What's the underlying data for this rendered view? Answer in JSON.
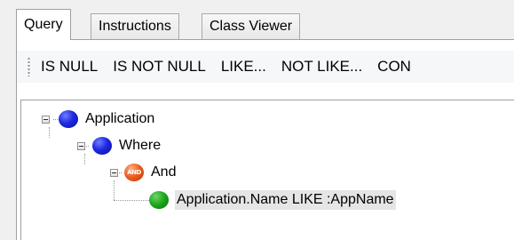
{
  "tabs": [
    {
      "label": "Query",
      "active": true
    },
    {
      "label": "Instructions",
      "active": false
    },
    {
      "label": "Class Viewer",
      "active": false
    }
  ],
  "toolbar": {
    "buttons": [
      "IS NULL",
      "IS NOT NULL",
      "LIKE...",
      "NOT LIKE...",
      "CON"
    ]
  },
  "tree": {
    "nodes": [
      {
        "label": "Application",
        "icon": "blue-circle-icon",
        "level": 0,
        "expanded": true
      },
      {
        "label": "Where",
        "icon": "blue-circle-icon",
        "level": 1,
        "expanded": true
      },
      {
        "label": "And",
        "icon": "and-operator-icon",
        "icon_text": "AND",
        "level": 2,
        "expanded": true
      },
      {
        "label": "Application.Name LIKE  :AppName",
        "icon": "green-circle-icon",
        "level": 3,
        "selected": true
      }
    ]
  },
  "colors": {
    "window_bg": "#f0f0f0",
    "toolbar_bg": "#f6f7f9",
    "node_blue": "#1d28e0",
    "node_green": "#1aa61a",
    "node_and": "#ea5a1a",
    "selection_bg": "#e5e5e5"
  }
}
